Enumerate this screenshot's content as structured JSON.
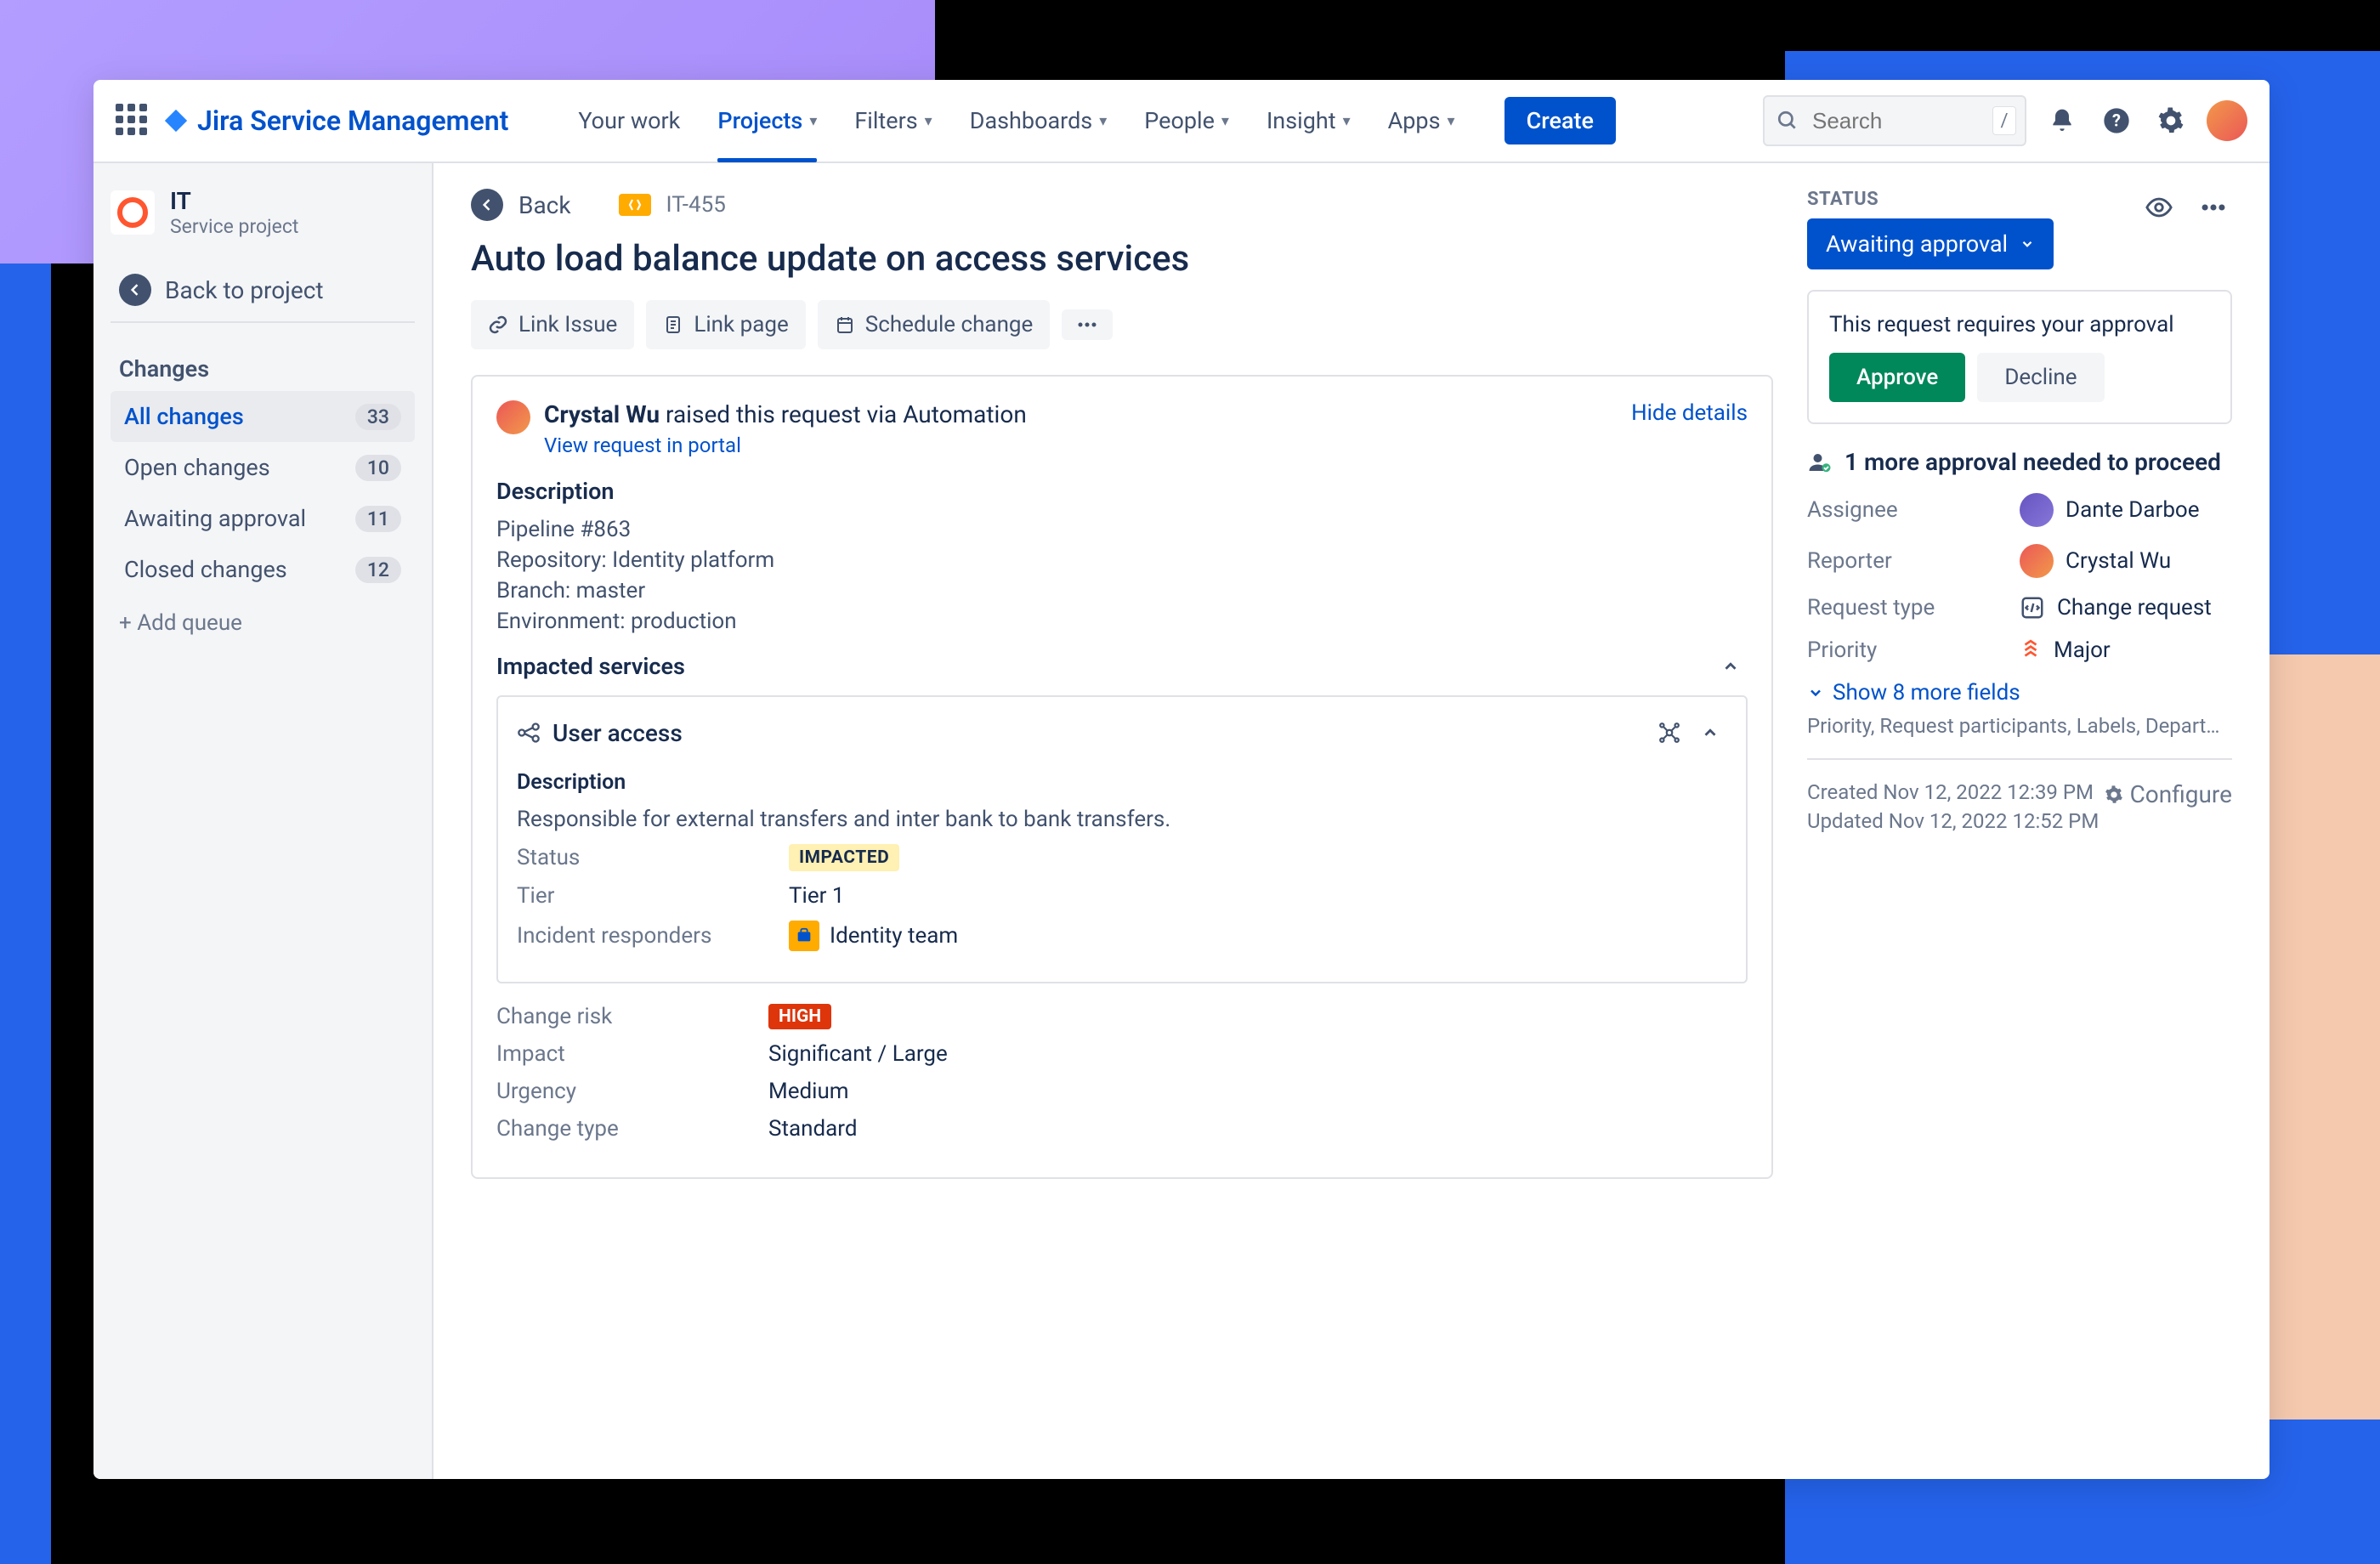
{
  "brand": "Jira Service Management",
  "nav": {
    "your_work": "Your work",
    "projects": "Projects",
    "filters": "Filters",
    "dashboards": "Dashboards",
    "people": "People",
    "insight": "Insight",
    "apps": "Apps"
  },
  "create_btn": "Create",
  "search": {
    "placeholder": "Search",
    "kbd": "/"
  },
  "project": {
    "name": "IT",
    "subtitle": "Service project",
    "back_to_project": "Back to project"
  },
  "sidebar": {
    "section_title": "Changes",
    "items": [
      {
        "label": "All changes",
        "count": "33",
        "active": true
      },
      {
        "label": "Open changes",
        "count": "10",
        "active": false
      },
      {
        "label": "Awaiting approval",
        "count": "11",
        "active": false
      },
      {
        "label": "Closed changes",
        "count": "12",
        "active": false
      }
    ],
    "add_queue": "+ Add queue"
  },
  "back_label": "Back",
  "issue": {
    "key": "IT-455",
    "title": "Auto load balance update on access services",
    "actions": {
      "link_issue": "Link Issue",
      "link_page": "Link page",
      "schedule_change": "Schedule change"
    },
    "reporter_name": "Crystal Wu",
    "raised_via": " raised this request via Automation",
    "view_in_portal": "View request in portal",
    "hide_details": "Hide details",
    "description_h": "Description",
    "pipeline_link": "Pipeline #863",
    "desc_lines": [
      "Repository: Identity platform",
      "Branch: master",
      "Environment: production"
    ],
    "impacted_h": "Impacted services",
    "service": {
      "name": "User access",
      "desc_h": "Description",
      "desc": "Responsible for external transfers and inter bank to bank transfers.",
      "status_label": "Status",
      "status_value": "IMPACTED",
      "tier_label": "Tier",
      "tier_value": "Tier 1",
      "responders_label": "Incident responders",
      "responders_value": "Identity team"
    },
    "change_risk_label": "Change risk",
    "change_risk_value": "HIGH",
    "impact_label": "Impact",
    "impact_value": "Significant / Large",
    "urgency_label": "Urgency",
    "urgency_value": "Medium",
    "change_type_label": "Change type",
    "change_type_value": "Standard"
  },
  "right": {
    "status_label": "STATUS",
    "status_value": "Awaiting approval",
    "approval_prompt": "This request requires your approval",
    "approve": "Approve",
    "decline": "Decline",
    "approval_needed": "1 more approval needed to proceed",
    "assignee_label": "Assignee",
    "assignee_value": "Dante Darboe",
    "reporter_label": "Reporter",
    "reporter_value": "Crystal Wu",
    "request_type_label": "Request type",
    "request_type_value": "Change request",
    "priority_label": "Priority",
    "priority_value": "Major",
    "show_more": "Show 8 more fields",
    "more_fields_hint": "Priority, Request participants, Labels, Department details, Organizations, T...",
    "created": "Created Nov 12, 2022 12:39 PM",
    "updated": "Updated Nov 12, 2022 12:52 PM",
    "configure": "Configure"
  }
}
